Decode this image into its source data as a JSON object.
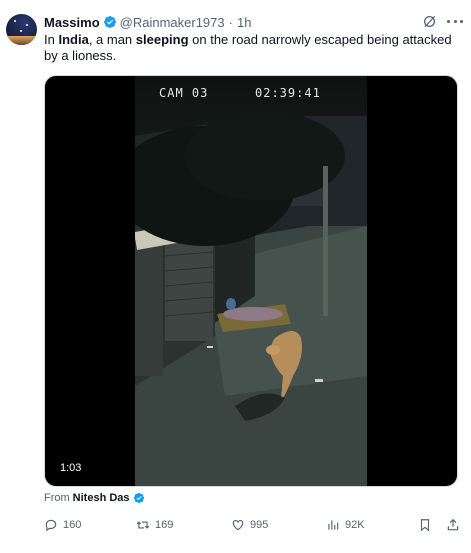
{
  "author": {
    "name": "Massimo",
    "handle": "@Rainmaker1973",
    "separator": "·",
    "time": "1h"
  },
  "tweet": {
    "text_parts": {
      "p1": "In ",
      "b1": "India",
      "p2": ", a man ",
      "b2": "sleeping",
      "p3": " on the road narrowly escaped being attacked by a lioness."
    }
  },
  "video": {
    "overlay_cam": "CAM 03",
    "overlay_time": "02:39:41",
    "duration": "1:03"
  },
  "source": {
    "label": "From",
    "name": "Nitesh Das"
  },
  "actions": {
    "replies": "160",
    "reposts": "169",
    "likes": "995",
    "views": "92K"
  },
  "colors": {
    "verified": "#1d9bf0",
    "secondary_text": "#536471",
    "primary_text": "#0f1419"
  }
}
